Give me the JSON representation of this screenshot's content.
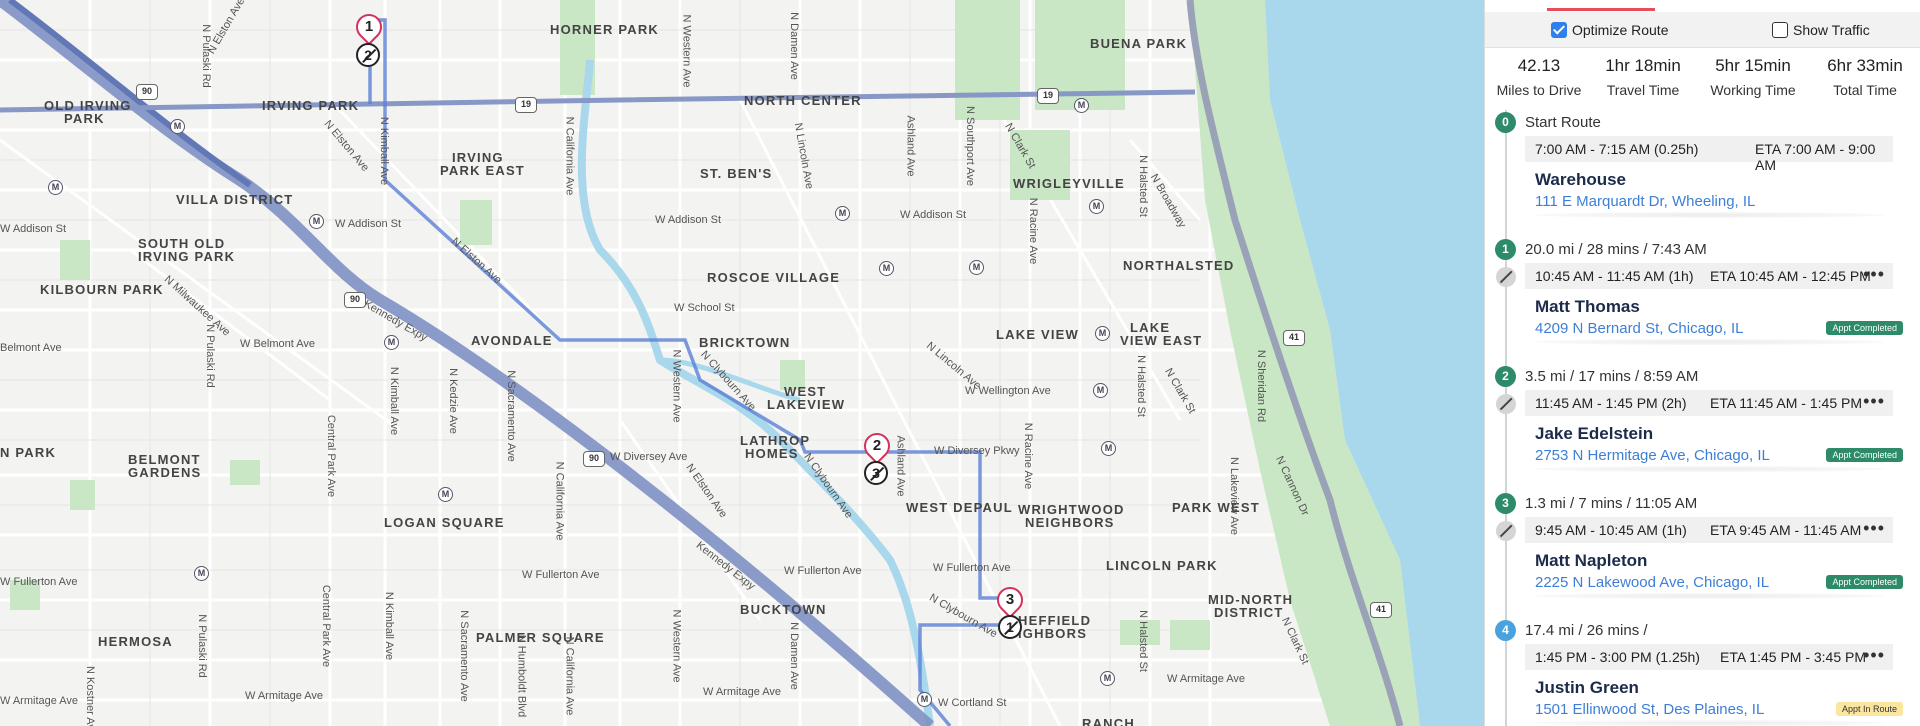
{
  "map": {
    "neighborhoods": [
      {
        "id": "horner-park",
        "text": "HORNER PARK"
      },
      {
        "id": "buena-park",
        "text": "BUENA PARK"
      },
      {
        "id": "old-irving-park-1",
        "text": "OLD IRVING"
      },
      {
        "id": "old-irving-park-2",
        "text": "PARK"
      },
      {
        "id": "irving-park",
        "text": "IRVING PARK"
      },
      {
        "id": "north-center",
        "text": "NORTH CENTER"
      },
      {
        "id": "irving-park-east-1",
        "text": "IRVING"
      },
      {
        "id": "irving-park-east-2",
        "text": "PARK EAST"
      },
      {
        "id": "st-bens",
        "text": "ST. BEN'S"
      },
      {
        "id": "villa-district",
        "text": "VILLA DISTRICT"
      },
      {
        "id": "wrigleyville",
        "text": "WRIGLEYVILLE"
      },
      {
        "id": "south-old-irving-1",
        "text": "SOUTH OLD"
      },
      {
        "id": "south-old-irving-2",
        "text": "IRVING PARK"
      },
      {
        "id": "kilbourn-park",
        "text": "KILBOURN PARK"
      },
      {
        "id": "roscoe-village",
        "text": "ROSCOE VILLAGE"
      },
      {
        "id": "northalsted",
        "text": "NORTHALSTED"
      },
      {
        "id": "avondale",
        "text": "AVONDALE"
      },
      {
        "id": "bricktown",
        "text": "BRICKTOWN"
      },
      {
        "id": "lake-view",
        "text": "LAKE VIEW"
      },
      {
        "id": "lake-view-east-1",
        "text": "LAKE"
      },
      {
        "id": "lake-view-east-2",
        "text": "VIEW EAST"
      },
      {
        "id": "west-lakeview-1",
        "text": "WEST"
      },
      {
        "id": "west-lakeview-2",
        "text": "LAKEVIEW"
      },
      {
        "id": "n-park",
        "text": "N PARK"
      },
      {
        "id": "belmont-gardens-1",
        "text": "BELMONT"
      },
      {
        "id": "belmont-gardens-2",
        "text": "GARDENS"
      },
      {
        "id": "lathrop-homes-1",
        "text": "LATHROP"
      },
      {
        "id": "lathrop-homes-2",
        "text": "HOMES"
      },
      {
        "id": "west-depaul",
        "text": "WEST DEPAUL"
      },
      {
        "id": "wrightwood-1",
        "text": "WRIGHTWOOD"
      },
      {
        "id": "wrightwood-2",
        "text": "NEIGHBORS"
      },
      {
        "id": "park-west",
        "text": "PARK WEST"
      },
      {
        "id": "logan-square",
        "text": "LOGAN SQUARE"
      },
      {
        "id": "lincoln-park",
        "text": "LINCOLN PARK"
      },
      {
        "id": "bucktown",
        "text": "BUCKTOWN"
      },
      {
        "id": "mid-north-1",
        "text": "MID-NORTH"
      },
      {
        "id": "mid-north-2",
        "text": "DISTRICT"
      },
      {
        "id": "hermosa",
        "text": "HERMOSA"
      },
      {
        "id": "palmer-square",
        "text": "PALMER SQUARE"
      },
      {
        "id": "sheffield-1",
        "text": "HEFFIELD"
      },
      {
        "id": "sheffield-2",
        "text": "IGHBORS"
      },
      {
        "id": "ranch",
        "text": "RANCH"
      }
    ],
    "streets": [
      {
        "id": "elston-top",
        "text": "N Elston Ave"
      },
      {
        "id": "pulaski-top",
        "text": "N Pulaski Rd"
      },
      {
        "id": "damen-top",
        "text": "N Damen Ave"
      },
      {
        "id": "western-top",
        "text": "N Western Ave"
      },
      {
        "id": "elston-mid",
        "text": "N Elston Ave"
      },
      {
        "id": "kimball-top",
        "text": "N Kimball Ave"
      },
      {
        "id": "california-top",
        "text": "N California Ave"
      },
      {
        "id": "lincoln-top",
        "text": "N Lincoln Ave"
      },
      {
        "id": "ashland-top",
        "text": "Ashland Ave"
      },
      {
        "id": "southport",
        "text": "N Southport Ave"
      },
      {
        "id": "clark-top",
        "text": "N Clark St"
      },
      {
        "id": "halsted-top",
        "text": "N Halsted St"
      },
      {
        "id": "broadway",
        "text": "N Broadway"
      },
      {
        "id": "addison-w",
        "text": "W Addison St"
      },
      {
        "id": "addison-w2",
        "text": "W Addison St"
      },
      {
        "id": "addison-mid",
        "text": "W Addison St"
      },
      {
        "id": "addison-e",
        "text": "W Addison St"
      },
      {
        "id": "elston-diag",
        "text": "N Elston Ave"
      },
      {
        "id": "racine-top",
        "text": "N Racine Ave"
      },
      {
        "id": "milwaukee",
        "text": "N Milwaukee Ave"
      },
      {
        "id": "pulaski-mid",
        "text": "N Pulaski Rd"
      },
      {
        "id": "kennedy-top",
        "text": "Kennedy Expy"
      },
      {
        "id": "school",
        "text": "W School St"
      },
      {
        "id": "belmont-w",
        "text": "Belmont Ave"
      },
      {
        "id": "belmont-mid",
        "text": "W Belmont Ave"
      },
      {
        "id": "kimball-mid",
        "text": "N Kimball Ave"
      },
      {
        "id": "kedzie",
        "text": "N Kedzie Ave"
      },
      {
        "id": "sacramento",
        "text": "N Sacramento Ave"
      },
      {
        "id": "central-park",
        "text": "Central Park Ave"
      },
      {
        "id": "western-mid",
        "text": "N Western Ave"
      },
      {
        "id": "clybourn-top",
        "text": "N Clybourn Ave"
      },
      {
        "id": "lincoln-mid",
        "text": "N Lincoln Ave"
      },
      {
        "id": "wellington",
        "text": "W Wellington Ave"
      },
      {
        "id": "clark-mid",
        "text": "N Clark St"
      },
      {
        "id": "halsted-mid",
        "text": "N Halsted St"
      },
      {
        "id": "sheridan",
        "text": "N Sheridan Rd"
      },
      {
        "id": "diversey-w",
        "text": "W Diversey Ave"
      },
      {
        "id": "diversey-e",
        "text": "W Diversey Pkwy"
      },
      {
        "id": "elston-low",
        "text": "N Elston Ave"
      },
      {
        "id": "california-mid",
        "text": "N California Ave"
      },
      {
        "id": "clybourn-mid",
        "text": "N Clybourn Ave"
      },
      {
        "id": "ashland-mid",
        "text": "Ashland Ave"
      },
      {
        "id": "racine-mid",
        "text": "N Racine Ave"
      },
      {
        "id": "cannon",
        "text": "N Cannon Dr"
      },
      {
        "id": "lakeview-ave",
        "text": "N Lakeview Ave"
      },
      {
        "id": "fullerton-w",
        "text": "W Fullerton Ave"
      },
      {
        "id": "fullerton-w2",
        "text": "W Fullerton Ave"
      },
      {
        "id": "fullerton-mid",
        "text": "W Fullerton Ave"
      },
      {
        "id": "fullerton-e",
        "text": "W Fullerton Ave"
      },
      {
        "id": "kennedy-low",
        "text": "Kennedy Expy"
      },
      {
        "id": "central-park-low",
        "text": "Central Park Ave"
      },
      {
        "id": "kimball-low",
        "text": "N Kimball Ave"
      },
      {
        "id": "pulaski-low",
        "text": "N Pulaski Rd"
      },
      {
        "id": "sacramento-low",
        "text": "N Sacramento Ave"
      },
      {
        "id": "humboldt",
        "text": "N Humboldt Blvd"
      },
      {
        "id": "california-low",
        "text": "N California Ave"
      },
      {
        "id": "western-low",
        "text": "N Western Ave"
      },
      {
        "id": "damen-low",
        "text": "N Damen Ave"
      },
      {
        "id": "clybourn-low",
        "text": "N Clybourn Ave"
      },
      {
        "id": "halsted-low",
        "text": "N Halsted St"
      },
      {
        "id": "clark-low",
        "text": "N Clark St"
      },
      {
        "id": "armitage-w",
        "text": "W Armitage Ave"
      },
      {
        "id": "armitage-w2",
        "text": "W Armitage Ave"
      },
      {
        "id": "armitage-mid",
        "text": "W Armitage Ave"
      },
      {
        "id": "armitage-e",
        "text": "W Armitage Ave"
      },
      {
        "id": "cortland",
        "text": "W Cortland St"
      },
      {
        "id": "kostner",
        "text": "N Kostner Ave"
      }
    ],
    "shields": {
      "h90a": "90",
      "h90b": "90",
      "h90c": "90",
      "h19a": "19",
      "h19b": "19",
      "h41a": "41",
      "h41b": "41"
    },
    "metro_symbol": "M",
    "route_pins": [
      {
        "label": "1"
      },
      {
        "label": "2"
      },
      {
        "label": "3"
      }
    ],
    "done_pins": [
      {
        "label": "2"
      },
      {
        "label": "3"
      },
      {
        "label": "1"
      }
    ]
  },
  "sidebar": {
    "optimize_route": "Optimize Route",
    "show_traffic": "Show Traffic",
    "stats": [
      {
        "value": "42.13",
        "label": "Miles to Drive"
      },
      {
        "value": "1hr 18min",
        "label": "Travel Time"
      },
      {
        "value": "5hr 15min",
        "label": "Working Time"
      },
      {
        "value": "6hr 33min",
        "label": "Total Time"
      }
    ],
    "stops": [
      {
        "num": "0",
        "head": "Start Route",
        "window": "7:00 AM - 7:15 AM (0.25h)",
        "eta": "ETA 7:00 AM - 9:00 AM",
        "name": "Warehouse",
        "address": "111 E Marquardt Dr, Wheeling, IL",
        "badge": "",
        "color": "#2e8b6a"
      },
      {
        "num": "1",
        "head": "20.0 mi / 28 mins / 7:43 AM",
        "window": "10:45 AM - 11:45 AM (1h)",
        "eta": "ETA 10:45 AM - 12:45 PM",
        "name": "Matt Thomas",
        "address": "4209 N Bernard St, Chicago, IL",
        "badge": "Appt Completed",
        "color": "#2e8b6a"
      },
      {
        "num": "2",
        "head": "3.5 mi / 17 mins / 8:59 AM",
        "window": "11:45 AM - 1:45 PM (2h)",
        "eta": "ETA 11:45 AM - 1:45 PM",
        "name": "Jake Edelstein",
        "address": "2753 N Hermitage Ave, Chicago, IL",
        "badge": "Appt Completed",
        "color": "#2e8b6a"
      },
      {
        "num": "3",
        "head": "1.3 mi / 7 mins / 11:05 AM",
        "window": "9:45 AM - 10:45 AM (1h)",
        "eta": "ETA 9:45 AM - 11:45 AM",
        "name": "Matt Napleton",
        "address": "2225 N Lakewood Ave, Chicago, IL",
        "badge": "Appt Completed",
        "color": "#2e8b6a"
      },
      {
        "num": "4",
        "head": "17.4 mi / 26 mins /",
        "window": "1:45 PM - 3:00 PM (1.25h)",
        "eta": "ETA 1:45 PM - 3:45 PM",
        "name": "Justin Green",
        "address": "1501 Ellinwood St, Des Plaines, IL",
        "badge": "Appt In Route",
        "color": "#4aa3df"
      }
    ],
    "more_symbol": "•••"
  }
}
